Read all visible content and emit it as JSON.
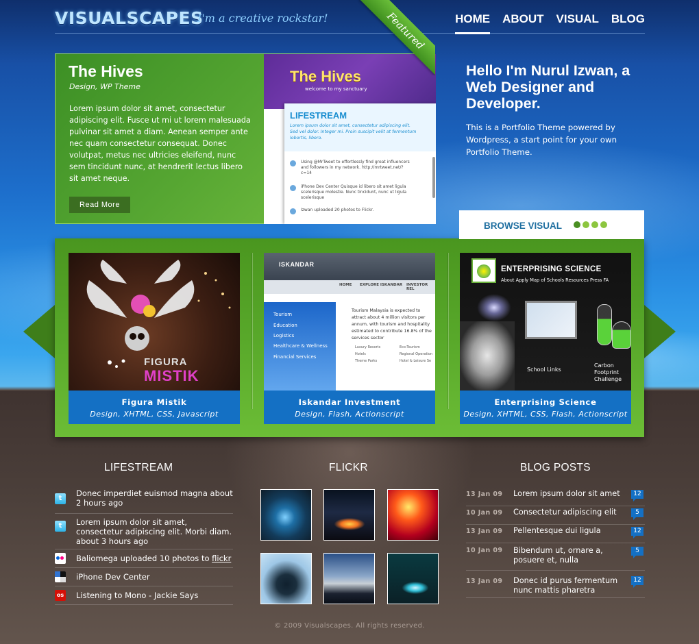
{
  "header": {
    "logo": "VISUALSCAPES",
    "tagline": "I'm a creative rockstar!",
    "nav": [
      "HOME",
      "ABOUT",
      "VISUAL",
      "BLOG"
    ]
  },
  "featured": {
    "title": "The Hives",
    "subtitle": "Design, WP Theme",
    "body": "Lorem ipsum dolor sit amet, consectetur adipiscing elit. Fusce ut mi ut lorem malesuada pulvinar sit amet a diam. Aenean semper ante nec quam consectetur consequat. Donec volutpat, metus nec ultricies eleifend, nunc sem tincidunt nunc, at hendrerit lectus libero sit amet neque.",
    "button": "Read More",
    "badge": "Featured",
    "screenshot": {
      "title": "The Hives",
      "subtitle": "welcome to my sanctuary",
      "heading": "LIFESTREAM",
      "intro": "Lorem ipsum dolor sit amet, consectetur adipiscing elit. Sed vel dolor. Integer mi. Proin suscipit velit at fermentum lobortis, libero.",
      "rows": [
        "Using @MrTweet to effortlessly find great influencers and followers in my network. http://mrtweet.net/?c=14",
        "iPhone Dev Center Quisque id libero sit amet ligula scelerisque molestie. Nunc tincidunt, nunc ut ligula scelerisque",
        "Izwan uploaded 20 photos to Flickr."
      ]
    }
  },
  "intro": {
    "title": "Hello I'm Nurul Izwan, a Web Designer and Developer.",
    "text": "This is a Portfolio Theme powered by Wordpress, a start point for your own Portfolio Theme."
  },
  "browse": {
    "label": "BROWSE VISUAL",
    "dots": 4,
    "active_dot": 1
  },
  "portfolio": [
    {
      "title": "Figura Mistik",
      "tags": "Design, XHTML, CSS, Javascript",
      "art": {
        "line1": "FIGURA",
        "line2": "MISTIK"
      }
    },
    {
      "title": "Iskandar Investment",
      "tags": "Design, Flash, Actionscript",
      "art": {
        "logo": "ISKANDAR",
        "nav": [
          "HOME",
          "EXPLORE ISKANDAR",
          "INVESTOR REL"
        ],
        "menu": [
          "Tourism",
          "Education",
          "Logistics",
          "Healthcare & Wellness",
          "Financial Services"
        ],
        "text": "Tourism Malaysia is expected to attract about 4 million visitors per annum, with tourism and hospitality estimated to contribute 16.8% of the services sector",
        "bullets": [
          "Luxury Resorts",
          "Eco-Tourism",
          "Hotels",
          "Regional Operation",
          "Theme Parks",
          "Hotel & Leisure Se"
        ]
      }
    },
    {
      "title": "Enterprising Science",
      "tags": "Design, XHTML, CSS, Flash, Actionscript",
      "art": {
        "logo": "bp",
        "heading": "ENTERPRISING SCIENCE",
        "nav": "About   Apply   Map of Schools   Resources   Press   FA",
        "school_links": "School Links",
        "carbon": "Carbon Footprint Challenge"
      }
    }
  ],
  "lifestream": {
    "title": "LIFESTREAM",
    "items": [
      {
        "icon": "twitter-icon",
        "text": "Donec imperdiet euismod magna about 2 hours ago"
      },
      {
        "icon": "twitter-icon",
        "text": "Lorem ipsum dolor sit amet, consectetur adipiscing elit. Morbi diam. about 3 hours ago"
      },
      {
        "icon": "flickr-icon",
        "text": "Baliomega uploaded 10 photos to",
        "link": "flickr"
      },
      {
        "icon": "delicious-icon",
        "text": "iPhone Dev Center"
      },
      {
        "icon": "lastfm-icon",
        "text": "Listening to Mono - Jackie Says"
      }
    ]
  },
  "flickr": {
    "title": "FLICKR",
    "photos": 6
  },
  "blog": {
    "title": "BLOG POSTS",
    "posts": [
      {
        "date": "13 Jan 09",
        "title": "Lorem ipsum dolor sit amet",
        "comments": "12"
      },
      {
        "date": "10 Jan 09",
        "title": "Consectetur adipiscing elit",
        "comments": "5"
      },
      {
        "date": "13 Jan 09",
        "title": "Pellentesque dui ligula",
        "comments": "12"
      },
      {
        "date": "10 Jan 09",
        "title": "Bibendum ut, ornare a, posuere et, nulla",
        "comments": "5"
      },
      {
        "date": "13 Jan 09",
        "title": "Donec id purus fermentum nunc mattis pharetra",
        "comments": "12"
      }
    ]
  },
  "footer": "© 2009 Visualscapes. All rights reserved.",
  "colors": {
    "brand_green": "#58a82a",
    "caption_blue": "#1470c4",
    "browse_blue": "#1f6fa0"
  }
}
